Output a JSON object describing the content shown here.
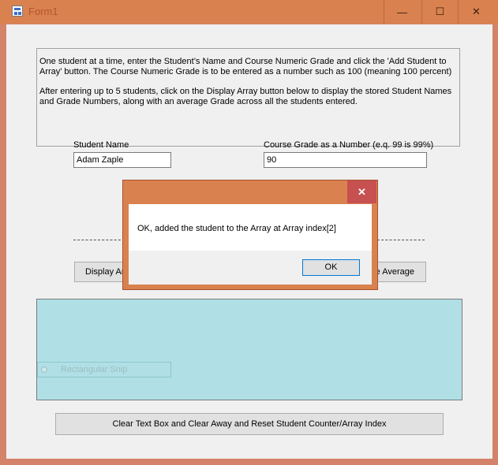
{
  "window": {
    "title": "Form1",
    "controls": {
      "minimize": "—",
      "maximize": "☐",
      "close": "✕"
    }
  },
  "instructions": {
    "paragraph1": "One student at a time, enter the Student’s Name and Course Numeric Grade and click the 'Add Student to Array' button. The Course Numeric Grade is to be entered as a number such as 100 (meaning 100 percent)",
    "paragraph2": "After entering up to 5 students, click on the Display Array button below to display the stored Student Names and Grade Numbers, along with an average Grade across all the students entered."
  },
  "form": {
    "student_name_label": "Student Name",
    "student_name_value": "Adam Zaple",
    "grade_label": "Course Grade as a Number (e.q. 99 is 99%)",
    "grade_value": "90"
  },
  "buttons": {
    "display_array_partial": "Display Ar",
    "average_partial": "e Average",
    "clear_reset": "Clear Text Box and Clear Away and Reset Student Counter/Array Index"
  },
  "overlay": {
    "snip_label": "Rectangular Snip"
  },
  "dialog": {
    "close": "✕",
    "message": "OK, added the student to the Array at Array index[2]",
    "ok": "OK"
  },
  "colors": {
    "title_bar": "#d9824f",
    "output_background": "#b0e0e6",
    "dialog_close": "#c75050"
  }
}
